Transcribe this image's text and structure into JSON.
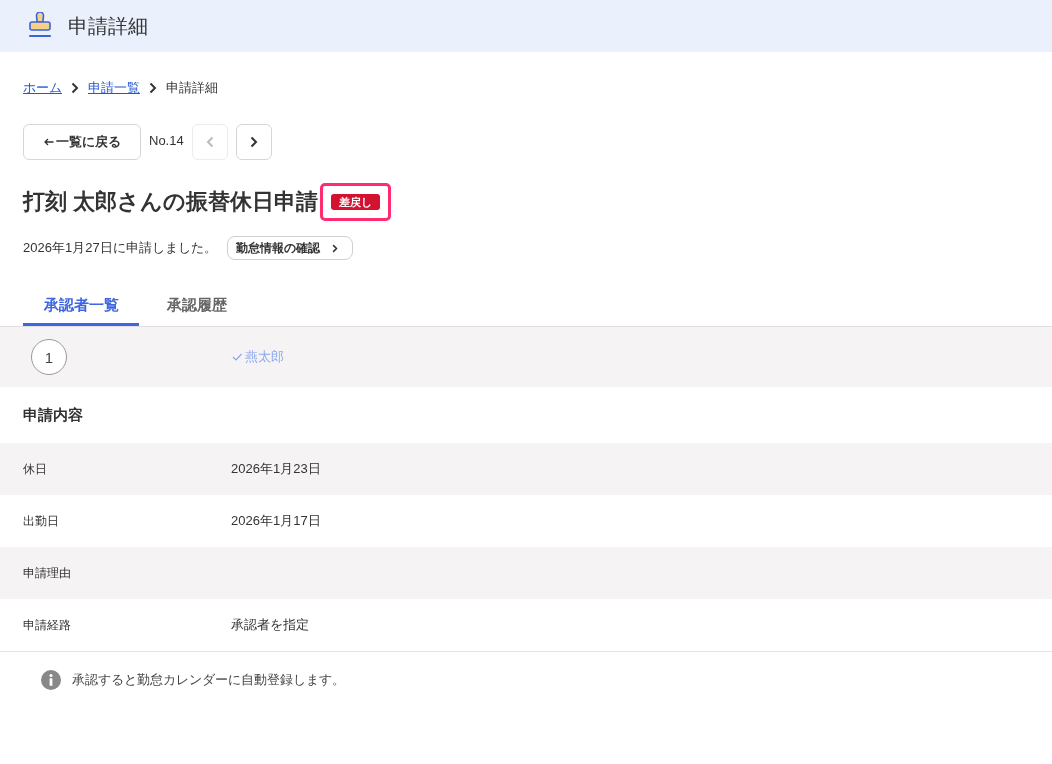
{
  "header": {
    "title": "申請詳細"
  },
  "breadcrumb": [
    {
      "label": "ホーム",
      "kind": "link"
    },
    {
      "label": "申請一覧",
      "kind": "link"
    },
    {
      "label": "申請詳細",
      "kind": "current"
    }
  ],
  "navigation": {
    "back_button": "一覧に戻る",
    "number": "No.14",
    "prev": {
      "disabled": true
    },
    "next": {
      "disabled": false
    }
  },
  "title": "打刻 太郎さんの振替休日申請",
  "status_badge": {
    "label": "差戻し",
    "highlighted": true
  },
  "submitted_text": "2026年1月27日に申請しました。",
  "attendance_button": {
    "label": "勤怠情報の確認"
  },
  "tabs": [
    {
      "label": "承認者一覧",
      "selected": true
    },
    {
      "label": "承認履歴",
      "selected": false
    }
  ],
  "approvers": [
    {
      "step": "1",
      "name": "燕太郎",
      "approved": true
    }
  ],
  "details": {
    "title": "申請内容",
    "rows": [
      {
        "label": "休日",
        "value": "2026年1月23日"
      },
      {
        "label": "出勤日",
        "value": "2026年1月17日"
      },
      {
        "label": "申請理由"
      },
      {
        "label": "申請経路",
        "value": "承認者を指定"
      }
    ]
  },
  "notice": {
    "text": "承認すると勤怠カレンダーに自動登録します。"
  }
}
